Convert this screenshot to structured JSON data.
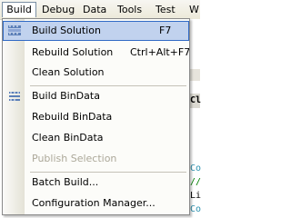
{
  "menubar": {
    "items": [
      "Build",
      "Debug",
      "Data",
      "Tools",
      "Test",
      "W"
    ]
  },
  "editor": {
    "lines": [
      "Cl",
      "Co",
      "//",
      "Li",
      "Co"
    ]
  },
  "menu": {
    "items": [
      {
        "label": "Build Solution",
        "shortcut": "F7",
        "icon": "build-solution-icon"
      },
      {
        "label": "Rebuild Solution",
        "shortcut": "Ctrl+Alt+F7"
      },
      {
        "label": "Clean Solution"
      },
      {
        "label": "Build BinData",
        "icon": "build-project-icon"
      },
      {
        "label": "Rebuild BinData"
      },
      {
        "label": "Clean BinData"
      },
      {
        "label": "Publish Selection",
        "disabled": true
      },
      {
        "label": "Batch Build..."
      },
      {
        "label": "Configuration Manager..."
      }
    ]
  },
  "colors": {
    "highlight_fill": "#c1d2ee",
    "highlight_border": "#316ac5",
    "disabled_text": "#aca899"
  }
}
